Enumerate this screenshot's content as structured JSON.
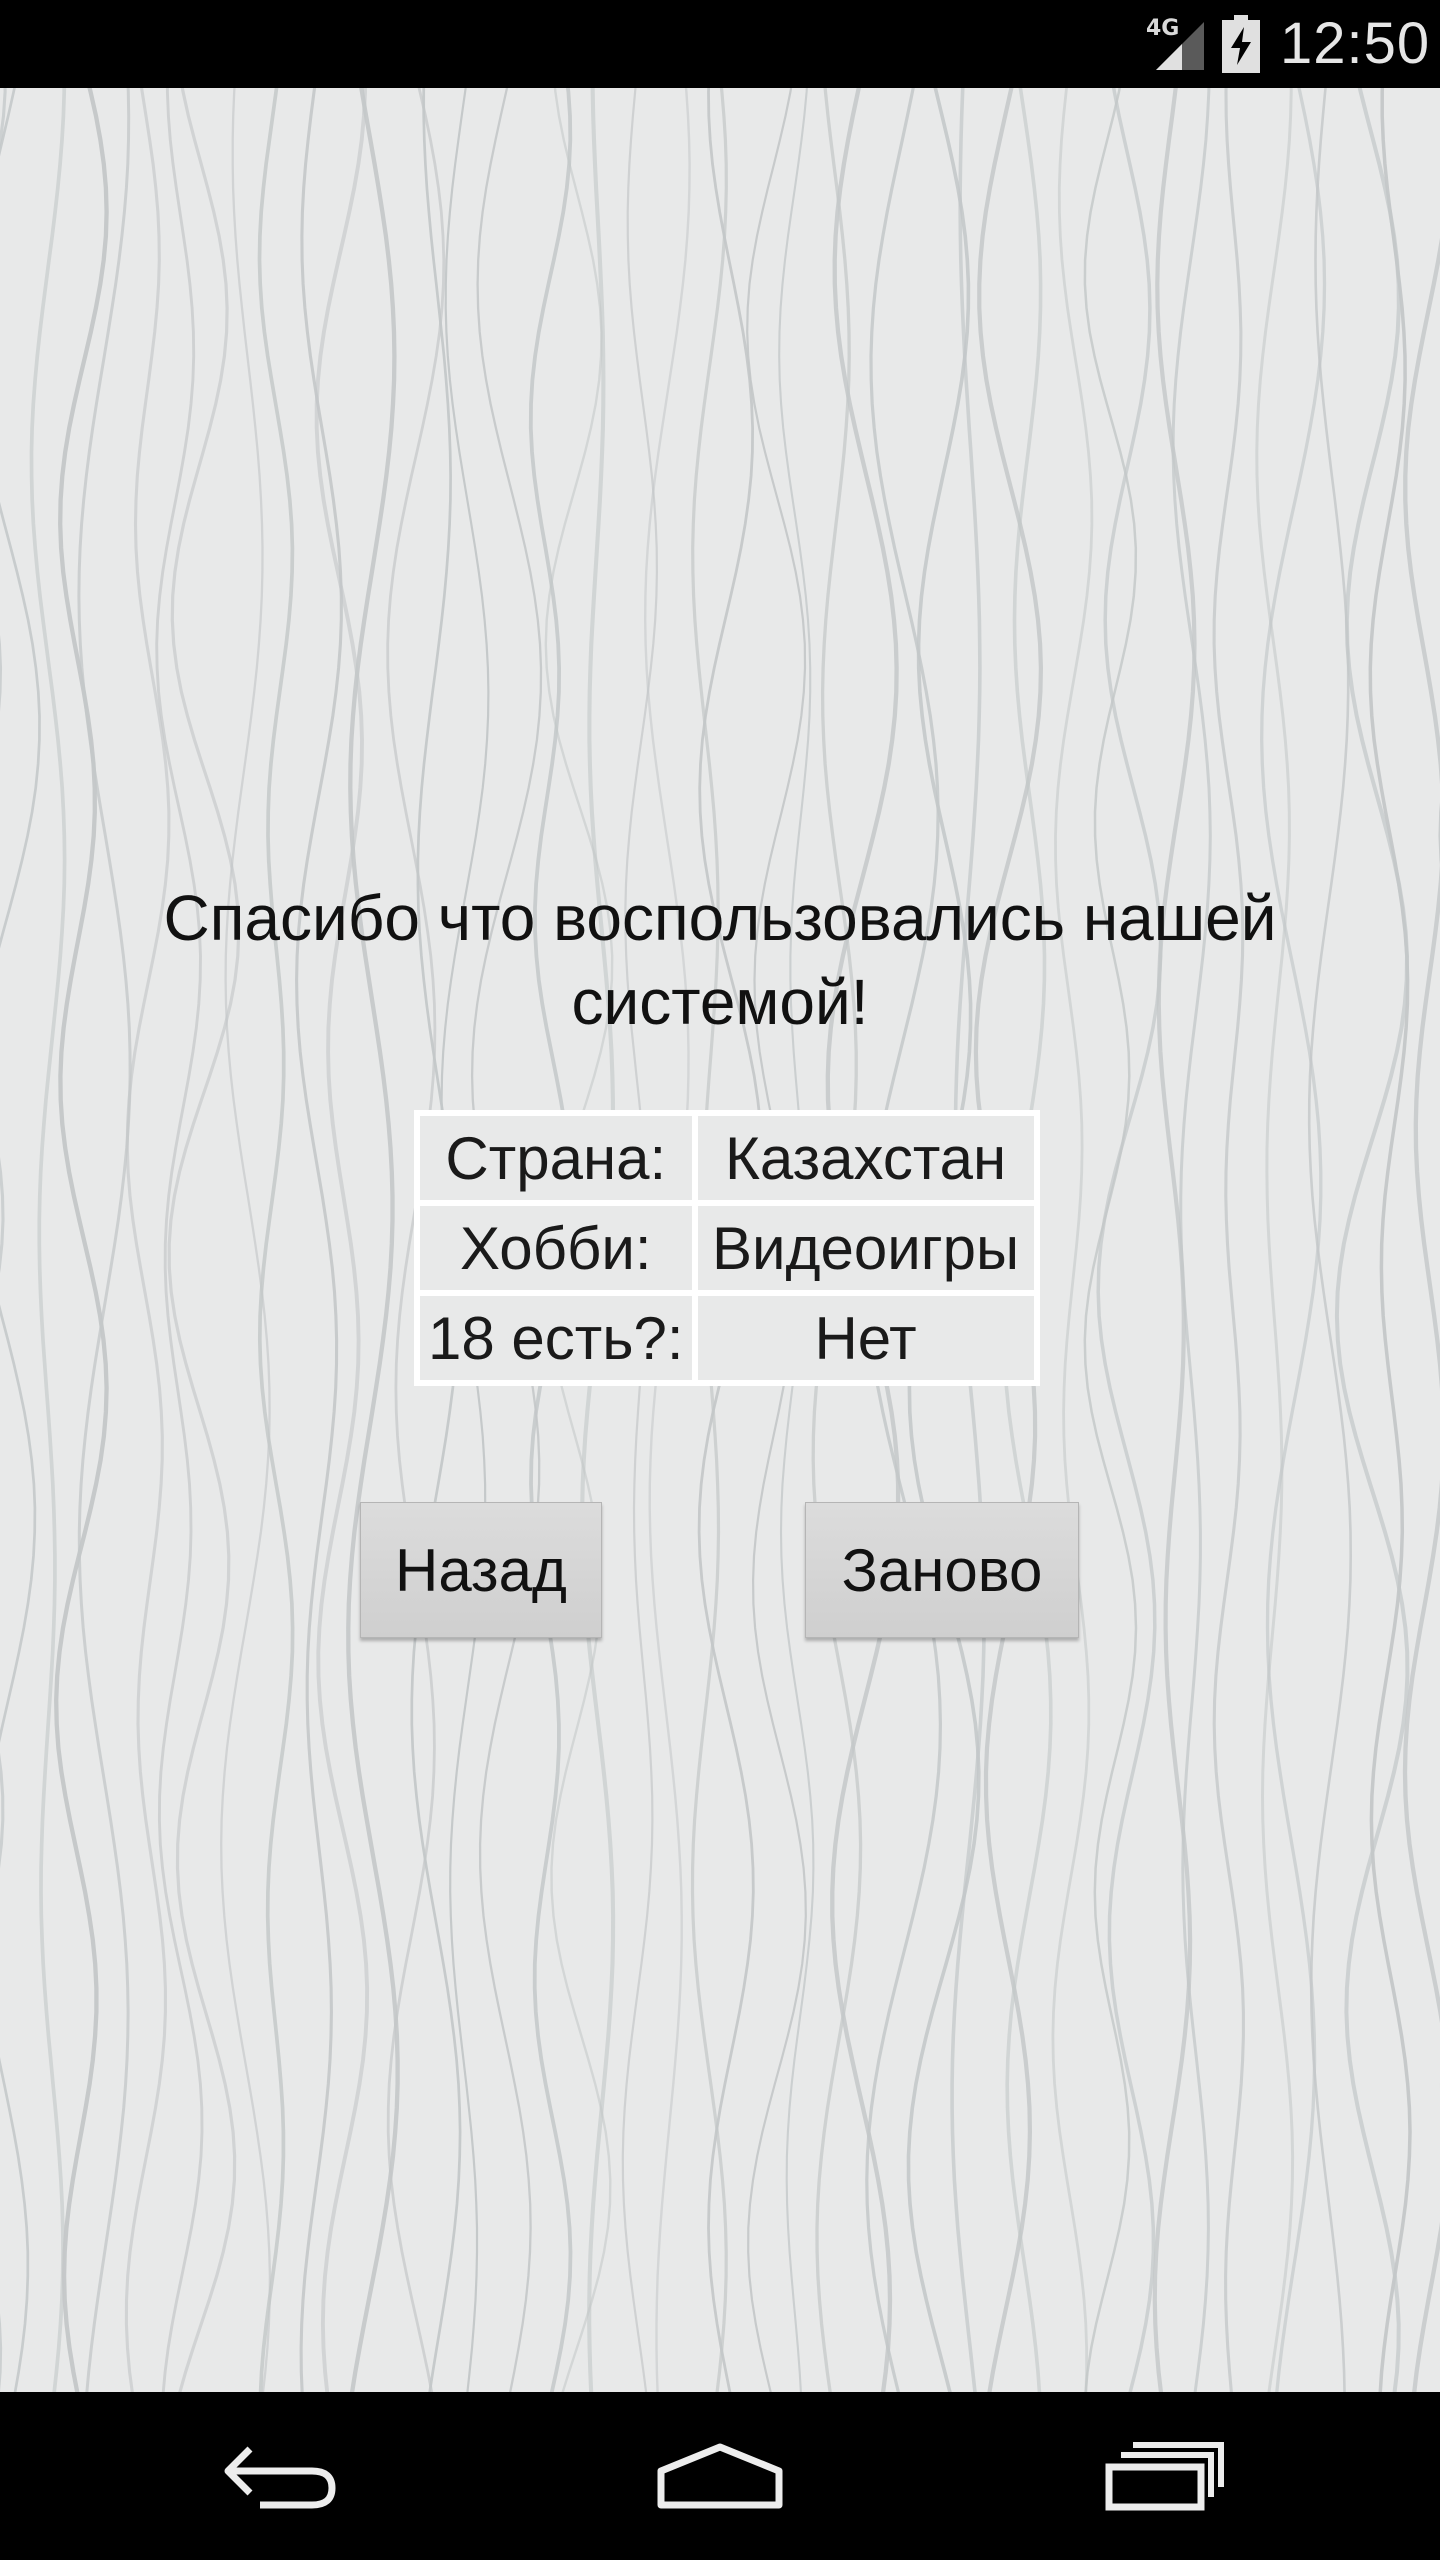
{
  "status_bar": {
    "network_type": "4G",
    "time": "12:50",
    "icons": [
      "signal-icon",
      "battery-charging-icon"
    ]
  },
  "main": {
    "message": "Спасибо что воспользовались нашей системой!",
    "table": [
      {
        "label": "Страна:",
        "value": "Казахстан"
      },
      {
        "label": "Хобби:",
        "value": "Видеоигры"
      },
      {
        "label": "18 есть?:",
        "value": "Нет"
      }
    ],
    "back_button_label": "Назад",
    "restart_button_label": "Заново"
  },
  "nav_bar": {
    "icons": [
      "back-icon",
      "home-icon",
      "recents-icon"
    ]
  }
}
